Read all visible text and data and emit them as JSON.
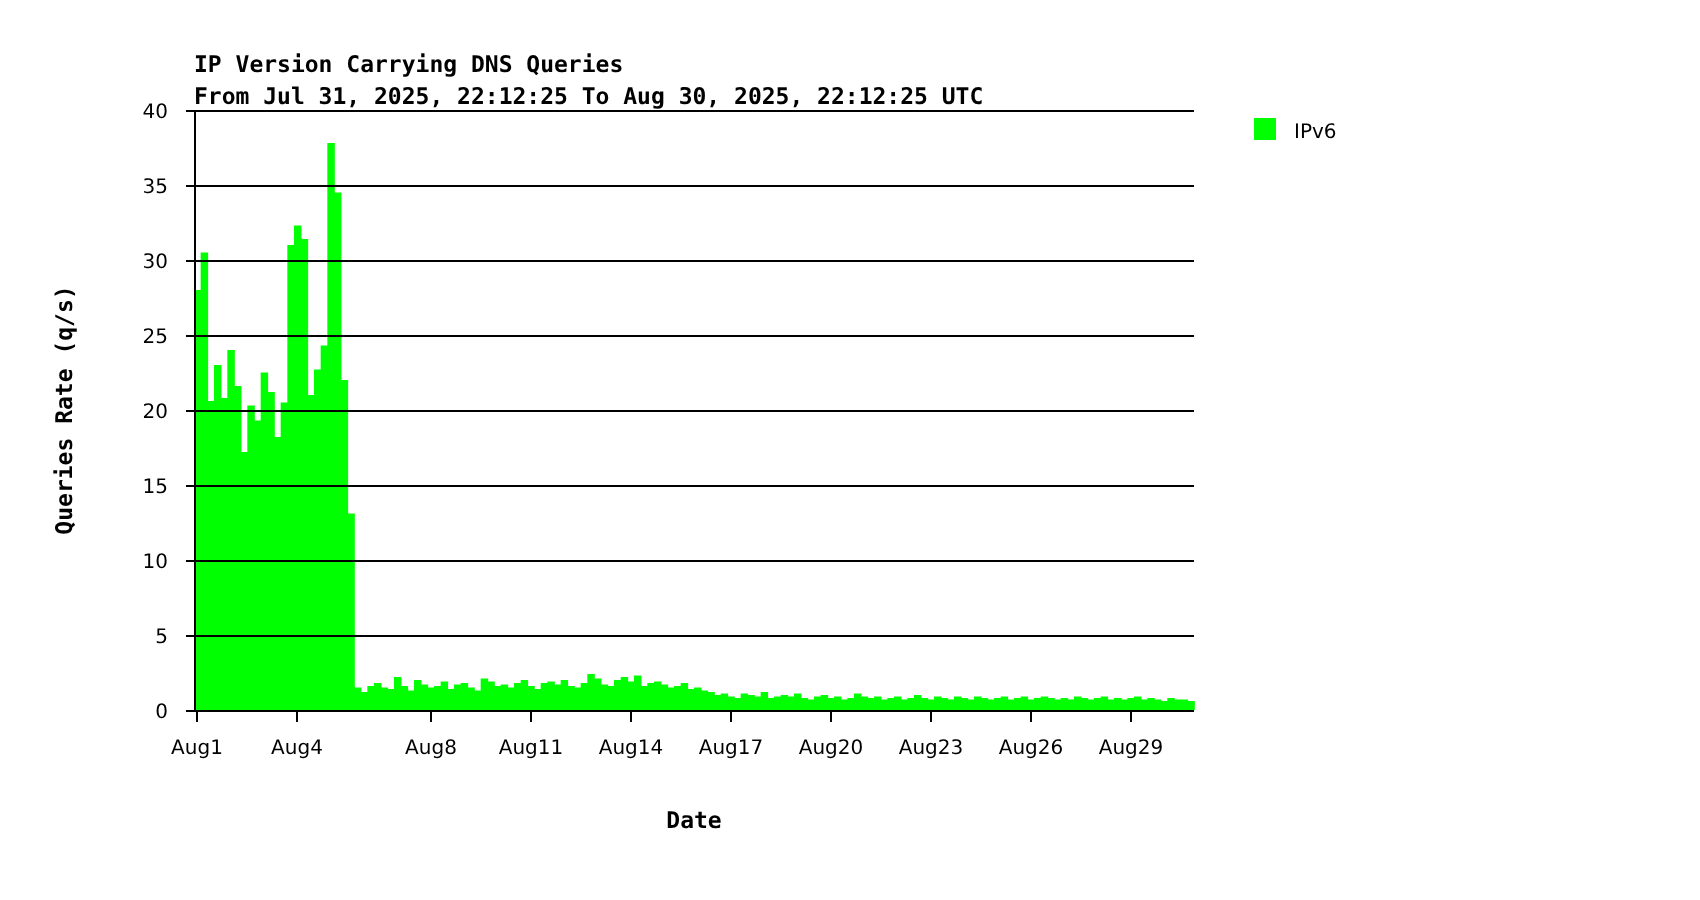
{
  "chart": {
    "subtitle": "From Jul 31, 2025, 22:12:25 To Aug 30, 2025, 22:12:25 UTC",
    "chart_data": {
      "type": "bar",
      "title": "IP Version Carrying DNS Queries",
      "xlabel": "Date",
      "ylabel": "Queries Rate (q/s)",
      "grid": true,
      "categories": [
        "Aug1",
        null,
        null,
        null,
        null,
        null,
        null,
        null,
        null,
        null,
        null,
        null,
        null,
        null,
        null,
        "Aug4",
        null,
        null,
        null,
        null,
        null,
        null,
        null,
        null,
        null,
        null,
        null,
        null,
        null,
        null,
        null,
        null,
        null,
        null,
        null,
        "Aug8",
        null,
        null,
        null,
        null,
        null,
        null,
        null,
        null,
        null,
        null,
        null,
        null,
        null,
        null,
        "Aug11",
        null,
        null,
        null,
        null,
        null,
        null,
        null,
        null,
        null,
        null,
        null,
        null,
        null,
        null,
        "Aug14",
        null,
        null,
        null,
        null,
        null,
        null,
        null,
        null,
        null,
        null,
        null,
        null,
        null,
        null,
        "Aug17",
        null,
        null,
        null,
        null,
        null,
        null,
        null,
        null,
        null,
        null,
        null,
        null,
        null,
        null,
        "Aug20",
        null,
        null,
        null,
        null,
        null,
        null,
        null,
        null,
        null,
        null,
        null,
        null,
        null,
        null,
        "Aug23",
        null,
        null,
        null,
        null,
        null,
        null,
        null,
        null,
        null,
        null,
        null,
        null,
        null,
        null,
        "Aug26",
        null,
        null,
        null,
        null,
        null,
        null,
        null,
        null,
        null,
        null,
        null,
        null,
        null,
        null,
        "Aug29",
        null,
        null,
        null,
        null,
        null,
        null,
        null,
        null,
        null
      ],
      "ylim": [
        0,
        40
      ],
      "yticks": [
        0,
        5,
        10,
        15,
        20,
        25,
        30,
        35,
        40
      ],
      "series": [
        {
          "name": "IPv6",
          "color": "#00ff00",
          "values": [
            28,
            30.5,
            20.6,
            23,
            20.8,
            24,
            21.6,
            17.2,
            20.3,
            19.3,
            22.5,
            21.2,
            18.2,
            20.5,
            31,
            32.3,
            31.4,
            21,
            22.7,
            24.3,
            37.8,
            34.5,
            22,
            13.1,
            1.5,
            1.2,
            1.6,
            1.8,
            1.5,
            1.4,
            2.2,
            1.6,
            1.3,
            2.0,
            1.7,
            1.5,
            1.6,
            1.9,
            1.4,
            1.7,
            1.8,
            1.5,
            1.3,
            2.1,
            1.9,
            1.6,
            1.7,
            1.5,
            1.8,
            2.0,
            1.6,
            1.4,
            1.8,
            1.9,
            1.7,
            2.0,
            1.6,
            1.5,
            1.8,
            2.4,
            2.1,
            1.7,
            1.6,
            2.0,
            2.2,
            1.9,
            2.3,
            1.6,
            1.8,
            1.9,
            1.7,
            1.5,
            1.6,
            1.8,
            1.4,
            1.5,
            1.3,
            1.2,
            1.0,
            1.1,
            0.9,
            0.8,
            1.1,
            1.0,
            0.9,
            1.2,
            0.8,
            0.9,
            1.0,
            0.9,
            1.1,
            0.8,
            0.7,
            0.9,
            1.0,
            0.8,
            0.9,
            0.7,
            0.8,
            1.1,
            0.9,
            0.8,
            0.9,
            0.7,
            0.8,
            0.9,
            0.7,
            0.8,
            1.0,
            0.8,
            0.7,
            0.9,
            0.8,
            0.7,
            0.9,
            0.8,
            0.7,
            0.9,
            0.8,
            0.7,
            0.8,
            0.9,
            0.7,
            0.8,
            0.9,
            0.7,
            0.8,
            0.9,
            0.8,
            0.7,
            0.8,
            0.7,
            0.9,
            0.8,
            0.7,
            0.8,
            0.9,
            0.7,
            0.8,
            0.7,
            0.8,
            0.9,
            0.7,
            0.8,
            0.7,
            0.6,
            0.8,
            0.7,
            0.7,
            0.6
          ]
        }
      ]
    }
  }
}
